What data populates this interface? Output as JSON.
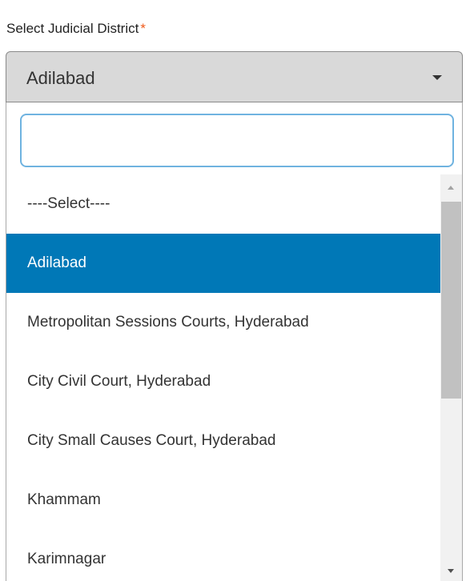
{
  "field": {
    "label": "Select Judicial District",
    "required_marker": "*",
    "selected_value": "Adilabad"
  },
  "dropdown": {
    "search": {
      "value": "",
      "placeholder": ""
    },
    "options": [
      {
        "label": "----Select----",
        "selected": false
      },
      {
        "label": "Adilabad",
        "selected": true
      },
      {
        "label": "Metropolitan Sessions Courts, Hyderabad",
        "selected": false
      },
      {
        "label": "City Civil Court, Hyderabad",
        "selected": false
      },
      {
        "label": "City Small Causes Court, Hyderabad",
        "selected": false
      },
      {
        "label": "Khammam",
        "selected": false
      },
      {
        "label": "Karimnagar",
        "selected": false
      }
    ],
    "selected_color": "#0078b7",
    "required_color": "#f05a1a",
    "focus_border_color": "#6fb3e0"
  }
}
